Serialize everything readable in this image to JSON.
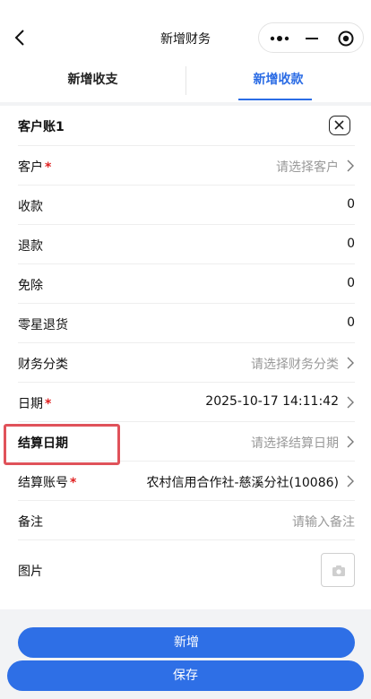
{
  "nav": {
    "title": "新增财务"
  },
  "tabs": [
    {
      "label": "新增收支",
      "active": false
    },
    {
      "label": "新增收款",
      "active": true
    }
  ],
  "card": {
    "title": "客户账1",
    "rows": [
      {
        "label": "客户",
        "required": true,
        "value": "请选择客户",
        "placeholder": true,
        "arrow": true
      },
      {
        "label": "收款",
        "required": false,
        "value": "0",
        "placeholder": false,
        "arrow": false
      },
      {
        "label": "退款",
        "required": false,
        "value": "0",
        "placeholder": false,
        "arrow": false
      },
      {
        "label": "免除",
        "required": false,
        "value": "0",
        "placeholder": false,
        "arrow": false
      },
      {
        "label": "零星退货",
        "required": false,
        "value": "0",
        "placeholder": false,
        "arrow": false
      },
      {
        "label": "财务分类",
        "required": false,
        "value": "请选择财务分类",
        "placeholder": true,
        "arrow": true
      },
      {
        "label": "日期",
        "required": true,
        "value": "2025-10-17 14:11:42",
        "placeholder": false,
        "arrow": true
      },
      {
        "label": "结算日期",
        "required": false,
        "value": "请选择结算日期",
        "placeholder": true,
        "arrow": true
      },
      {
        "label": "结算账号",
        "required": true,
        "value": "农村信用合作社-慈溪分社(10086)",
        "placeholder": false,
        "arrow": true
      },
      {
        "label": "备注",
        "required": false,
        "value": "请输入备注",
        "placeholder": true,
        "arrow": false
      },
      {
        "label": "图片",
        "required": false,
        "value": "",
        "placeholder": false,
        "arrow": false
      }
    ]
  },
  "buttons": {
    "add": "新增",
    "save": "保存"
  },
  "colors": {
    "accent": "#2e6fe6",
    "required": "#e02020",
    "highlight": "#e0525a"
  }
}
